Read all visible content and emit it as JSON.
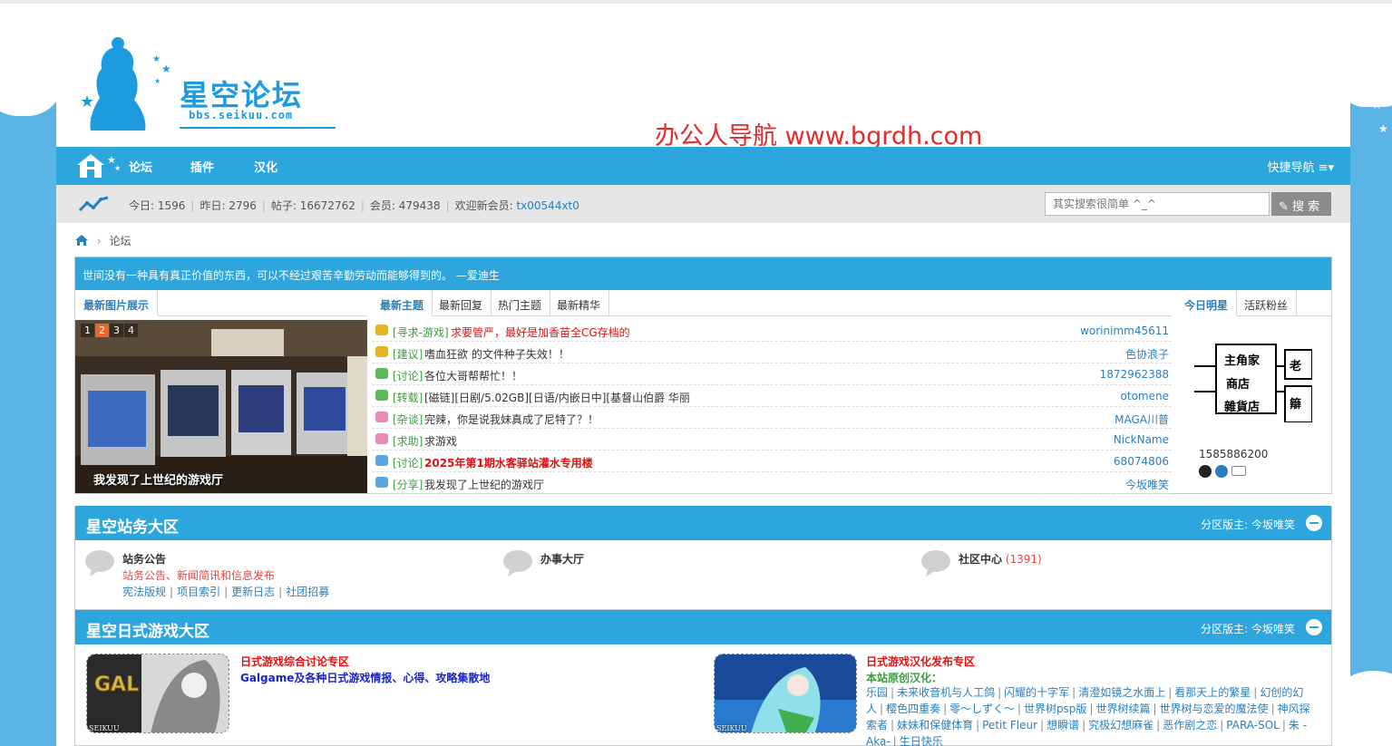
{
  "site": {
    "logo_title": "星空论坛",
    "logo_url": "bbs.seikuu.com",
    "watermark": "办公人导航  www.bgrdh.com"
  },
  "nav": {
    "items": [
      {
        "label": "论坛"
      },
      {
        "label": "插件"
      },
      {
        "label": "汉化"
      }
    ],
    "quick_nav": "快捷导航 ≡▾"
  },
  "stats": {
    "today": "今日: 1596",
    "yesterday": "昨日: 2796",
    "posts": "帖子: 16672762",
    "members": "会员: 479438",
    "welcome": "欢迎新会员: ",
    "new_member": "tx00544xt0"
  },
  "search": {
    "placeholder": "其实搜索很简单 ^_^",
    "button": "搜 索"
  },
  "breadcrumb": {
    "current": "论坛"
  },
  "notice": "世间没有一种具有真正价值的东西，可以不经过艰苦辛勤劳动而能够得到的。 —爱迪生",
  "left_panel": {
    "tab": "最新图片展示",
    "slide_numbers": [
      "1",
      "2",
      "3",
      "4"
    ],
    "active_slide": 2,
    "caption": "我发现了上世纪的游戏厅"
  },
  "mid_panel": {
    "tabs": [
      "最新主题",
      "最新回复",
      "热门主题",
      "最新精华"
    ],
    "threads": [
      {
        "category": "[寻求-游戏]",
        "title": "求要管严，最好是加香苗全CG存档的",
        "author": "worinimm45611",
        "title_color": "#e01010",
        "icon_color": "#e6b422"
      },
      {
        "category": "[建议]",
        "title": "嗜血狂欲 的文件种子失效！！",
        "author": "色协浪子",
        "title_color": "#333333",
        "icon_color": "#e6b422"
      },
      {
        "category": "[讨论]",
        "title": "各位大哥帮帮忙！！",
        "author": "1872962388",
        "title_color": "#333333",
        "icon_color": "#5cb85c"
      },
      {
        "category": "[转载]",
        "title": "[磁链][日剧/5.02GB][日语/内嵌日中][基督山伯爵 华丽",
        "author": "otomene",
        "title_color": "#333333",
        "icon_color": "#5cb85c"
      },
      {
        "category": "[杂谈]",
        "title": "完辣，你是说我妹真成了尼特了？！",
        "author": "MAGA川普",
        "title_color": "#333333",
        "icon_color": "#e88bb5"
      },
      {
        "category": "[求助]",
        "title": "求游戏",
        "author": "NickName",
        "title_color": "#333333",
        "icon_color": "#e88bb5"
      },
      {
        "category": "[讨论]",
        "title": "2025年第1期水客驿站灌水专用楼",
        "author": "68074806",
        "title_color": "#e01010",
        "icon_color": "#5aa6e0"
      },
      {
        "category": "[分享]",
        "title": "我发现了上世纪的游戏厅",
        "author": "今坂唯笑",
        "title_color": "#333333",
        "icon_color": "#5aa6e0"
      }
    ]
  },
  "right_panel": {
    "tabs": [
      "今日明星",
      "活跃粉丝"
    ],
    "star_sign_lines": [
      "主角家",
      "商店",
      "雜貨店"
    ],
    "star_sign_side": [
      "老",
      "䉸"
    ],
    "star_name": "1585886200"
  },
  "sections": [
    {
      "title": "星空站务大区",
      "moderator": "分区版主: 今坂唯笑",
      "forums": [
        {
          "name": "站务公告",
          "count": "",
          "desc": "站务公告、新闻简讯和信息发布",
          "links": [
            "宪法版规",
            "项目索引",
            "更新日志",
            "社团招募"
          ]
        },
        {
          "name": "办事大厅",
          "count": "",
          "desc": "",
          "links": []
        },
        {
          "name": "社区中心",
          "count": " (1391)",
          "desc": "",
          "links": []
        }
      ]
    },
    {
      "title": "星空日式游戏大区",
      "moderator": "分区版主: 今坂唯笑",
      "gal_forums": [
        {
          "thumb_badge": "GAL",
          "thumb_label": "SEIKUU",
          "name": "日式游戏综合讨论专区",
          "desc": "Galgame及各种日式游戏情报、心得、攻略集散地"
        },
        {
          "thumb_label": "SEIKUU",
          "name": "日式游戏汉化发布专区",
          "sub": "本站原创汉化：",
          "links": [
            "乐园",
            "未来收音机与人工鸽",
            "闪耀的十字军",
            "清澄如镜之水面上",
            "看那天上的繁星",
            "幻创的幻人",
            "樱色四重奏",
            "零～しずく～",
            "世界树psp版",
            "世界树续篇",
            "世界树与恋爱的魔法使",
            "神风探索者",
            "妹妹和保健体育",
            "Petit Fleur",
            "想瞬谱",
            "究极幻想麻雀",
            "恶作剧之恋",
            "PARA-SOL",
            "朱 -Aka-",
            "生日快乐"
          ]
        }
      ]
    }
  ],
  "colors": {
    "primary": "#2ca6dd",
    "background": "#5ab4e6",
    "link": "#2a7fbd",
    "highlight_red": "#e01010",
    "category_green": "#3a9d3a"
  }
}
